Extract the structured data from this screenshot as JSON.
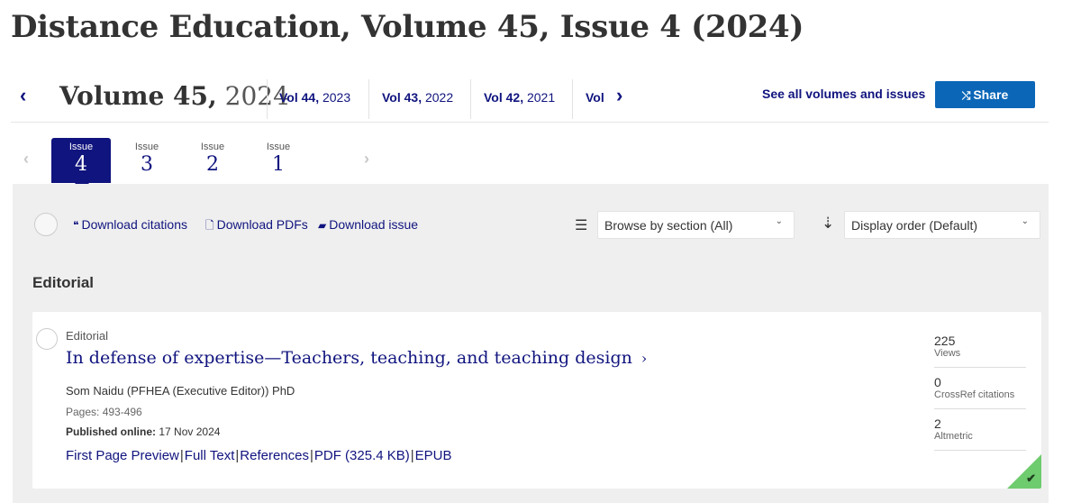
{
  "page": {
    "title": "Distance Education, Volume 45, Issue 4 (2024)"
  },
  "volume_nav": {
    "prev_icon": "chevron-left-icon",
    "current_label": "Volume 45,",
    "current_year": "2024",
    "volumes": [
      {
        "label": "Vol 44,",
        "year": "2023"
      },
      {
        "label": "Vol 43,",
        "year": "2022"
      },
      {
        "label": "Vol 42,",
        "year": "2021"
      },
      {
        "label": "Vol",
        "year": ""
      }
    ],
    "next_icon": "chevron-right-icon",
    "see_all": "See all volumes and issues",
    "share_label": "Share",
    "share_icon": "share-icon",
    "share_color": "#0b66b7"
  },
  "issue_nav": {
    "issue_label": "Issue",
    "issues": [
      {
        "number": "4",
        "active": true
      },
      {
        "number": "3",
        "active": false
      },
      {
        "number": "2",
        "active": false
      },
      {
        "number": "1",
        "active": false
      }
    ],
    "active_color": "#10147e"
  },
  "toolbar": {
    "download_citations": "Download citations",
    "download_pdfs": "Download PDFs",
    "download_issue": "Download issue",
    "browse_select": "Browse by section (All)",
    "order_select": "Display order (Default)"
  },
  "section": {
    "title": "Editorial"
  },
  "article": {
    "type": "Editorial",
    "title": "In defense of expertise—Teachers, teaching, and teaching design",
    "author": "Som Naidu (PFHEA (Executive Editor)) PhD",
    "pages": "Pages: 493-496",
    "published_label": "Published online:",
    "published_date": "17 Nov 2024",
    "links": [
      "First Page Preview",
      "Full Text",
      "References",
      "PDF (325.4 KB)",
      "EPUB"
    ],
    "metrics": [
      {
        "value": "225",
        "name": "Views"
      },
      {
        "value": "0",
        "name": "CrossRef citations"
      },
      {
        "value": "2",
        "name": "Altmetric"
      }
    ],
    "access_color": "#6ecb6e"
  }
}
